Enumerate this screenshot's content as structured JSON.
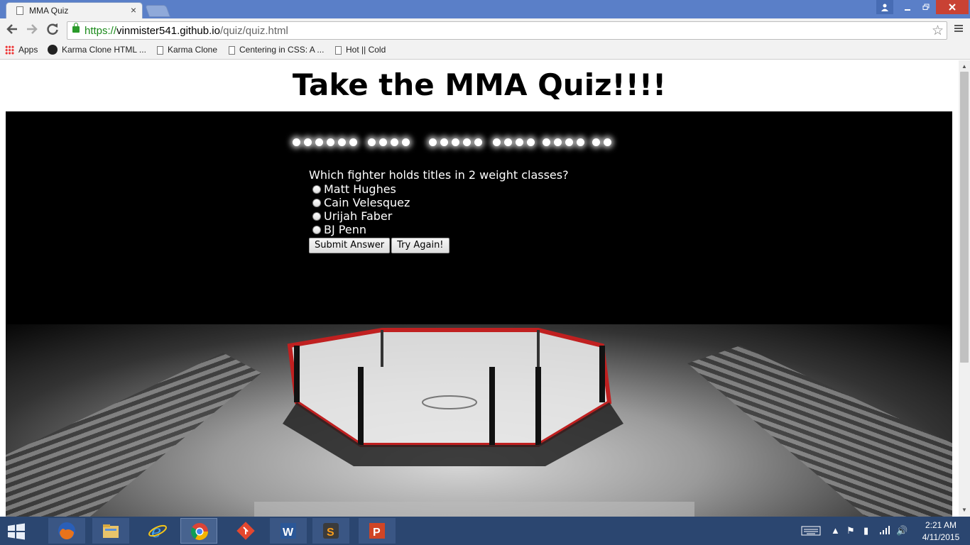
{
  "browser": {
    "tab_title": "MMA Quiz",
    "tab_close": "×",
    "url_scheme": "https://",
    "url_host": "vinmister541.github.io",
    "url_path": "/quiz/quiz.html",
    "bookmarks": [
      "Apps",
      "Karma Clone HTML ...",
      "Karma Clone",
      "Centering in CSS: A ...",
      "Hot || Cold"
    ]
  },
  "page": {
    "title": "Take the MMA Quiz!!!!",
    "question": "Which fighter holds titles in 2 weight classes?",
    "options": [
      "Matt Hughes",
      "Cain Velesquez",
      "Urijah Faber",
      "BJ Penn"
    ],
    "submit_label": "Submit Answer",
    "retry_label": "Try Again!"
  },
  "taskbar": {
    "apps": [
      "firefox-icon",
      "file-explorer-icon",
      "internet-explorer-icon",
      "chrome-icon",
      "git-icon",
      "word-icon",
      "sublime-text-icon",
      "powerpoint-icon"
    ],
    "time": "2:21 AM",
    "date": "4/11/2015"
  },
  "colors": {
    "titlebar": "#5a7fc8",
    "taskbar": "#2b4670",
    "close_button": "#c94234",
    "secure_green": "#1a8a1a"
  }
}
